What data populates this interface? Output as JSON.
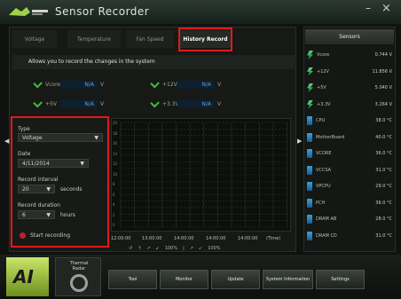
{
  "window": {
    "title": "Sensor Recorder",
    "minimize_glyph": "–",
    "close_glyph": "×"
  },
  "tabs": [
    {
      "label": "Voltage"
    },
    {
      "label": "Temperature"
    },
    {
      "label": "Fan Speed"
    },
    {
      "label": "History Record"
    }
  ],
  "info_text": "Allows you to record the changes in the system",
  "sensors": [
    {
      "name": "Vcore",
      "value": "N/A",
      "unit": "V"
    },
    {
      "name": "+12V",
      "value": "N/A",
      "unit": "V"
    },
    {
      "name": "+5V",
      "value": "N/A",
      "unit": "V"
    },
    {
      "name": "+3.3V",
      "value": "N/A",
      "unit": "V"
    }
  ],
  "settings": {
    "type_label": "Type",
    "type_value": "Voltage",
    "date_label": "Date",
    "date_value": "4/11/2014",
    "interval_label": "Record interval",
    "interval_value": "20",
    "interval_unit": "seconds",
    "duration_label": "Record duration",
    "duration_value": "6",
    "duration_unit": "hours",
    "start_label": "Start recording"
  },
  "graph": {
    "y_labels": [
      "20",
      "18",
      "16",
      "14",
      "12",
      "10",
      "8",
      "6",
      "4",
      "2",
      "0"
    ],
    "x_labels": [
      "12:00:00",
      "13:00:00",
      "14:00:00",
      "14:00:00",
      "14:00:00"
    ],
    "x_unit": "(Time)",
    "zoom_text": "100%",
    "zoom2_text": "100%"
  },
  "right_panel": {
    "header": "Sensors",
    "rows": [
      {
        "icon": "volt",
        "name": "Vcore",
        "value": "0.744 V"
      },
      {
        "icon": "volt",
        "name": "+12V",
        "value": "11.856 V"
      },
      {
        "icon": "volt",
        "name": "+5V",
        "value": "5.040 V"
      },
      {
        "icon": "volt",
        "name": "+3.3V",
        "value": "3.264 V"
      },
      {
        "icon": "temp",
        "name": "CPU",
        "value": "38.0 °C"
      },
      {
        "icon": "temp",
        "name": "MotherBoard",
        "value": "40.0 °C"
      },
      {
        "icon": "temp",
        "name": "VCORE",
        "value": "36.0 °C"
      },
      {
        "icon": "temp",
        "name": "VCCSA",
        "value": "31.0 °C"
      },
      {
        "icon": "temp",
        "name": "VPCPU",
        "value": "29.0 °C"
      },
      {
        "icon": "temp",
        "name": "PCH",
        "value": "36.0 °C"
      },
      {
        "icon": "temp",
        "name": "DRAM AB",
        "value": "28.0 °C"
      },
      {
        "icon": "temp",
        "name": "DRAM CD",
        "value": "31.0 °C"
      }
    ]
  },
  "bottom": {
    "logo_text": "AI",
    "thermal_label": "Thermal Radar",
    "buttons": [
      "Tool",
      "Monitor",
      "Update",
      "System Information",
      "Settings"
    ]
  }
}
